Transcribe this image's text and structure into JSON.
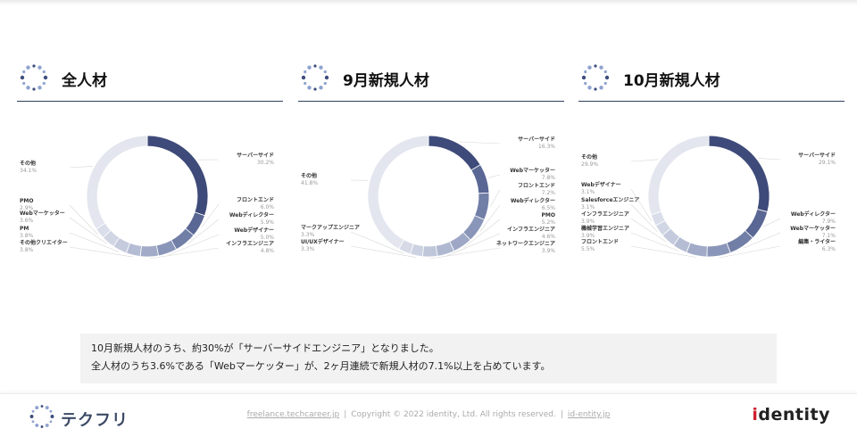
{
  "chart_data": [
    {
      "type": "pie",
      "donut": true,
      "title": "全人材",
      "slices": [
        {
          "name": "サーバーサイド",
          "value": 30.2,
          "label": "30.2%",
          "color": "#3e4a79"
        },
        {
          "name": "フロントエンド",
          "value": 6.0,
          "label": "6.0%",
          "color": "#5a6794"
        },
        {
          "name": "Webディレクター",
          "value": 5.9,
          "label": "5.9%",
          "color": "#717ea6"
        },
        {
          "name": "Webデザイナー",
          "value": 5.0,
          "label": "5.0%",
          "color": "#8a96b9"
        },
        {
          "name": "インフラエンジニア",
          "value": 4.8,
          "label": "4.8%",
          "color": "#a1abc8"
        },
        {
          "name": "その他クリエイター",
          "value": 3.8,
          "label": "3.8%",
          "color": "#b5bdd4"
        },
        {
          "name": "PM",
          "value": 3.8,
          "label": "3.8%",
          "color": "#c5cbdd"
        },
        {
          "name": "Webマーケッター",
          "value": 3.6,
          "label": "3.6%",
          "color": "#d1d6e4"
        },
        {
          "name": "PMO",
          "value": 2.9,
          "label": "2.9%",
          "color": "#dadeea"
        },
        {
          "name": "その他",
          "value": 34.1,
          "label": "34.1%",
          "color": "#e3e6ee"
        }
      ]
    },
    {
      "type": "pie",
      "donut": true,
      "title": "9月新規人材",
      "slices": [
        {
          "name": "サーバーサイド",
          "value": 16.3,
          "label": "16.3%",
          "color": "#3e4a79"
        },
        {
          "name": "Webマーケッター",
          "value": 7.8,
          "label": "7.8%",
          "color": "#5a6794"
        },
        {
          "name": "フロントエンド",
          "value": 7.2,
          "label": "7.2%",
          "color": "#717ea6"
        },
        {
          "name": "Webディレクター",
          "value": 6.5,
          "label": "6.5%",
          "color": "#8a96b9"
        },
        {
          "name": "PMO",
          "value": 5.2,
          "label": "5.2%",
          "color": "#9ea8c6"
        },
        {
          "name": "インフラエンジニア",
          "value": 4.6,
          "label": "4.6%",
          "color": "#afb8d0"
        },
        {
          "name": "ネットワークエンジニア",
          "value": 3.9,
          "label": "3.9%",
          "color": "#bfc6da"
        },
        {
          "name": "UI/UXデザイナー",
          "value": 3.3,
          "label": "3.3%",
          "color": "#ccd2e2"
        },
        {
          "name": "マークアップエンジニア",
          "value": 3.3,
          "label": "3.3%",
          "color": "#d6dae7"
        },
        {
          "name": "その他",
          "value": 41.8,
          "label": "41.8%",
          "color": "#e3e6ee"
        }
      ]
    },
    {
      "type": "pie",
      "donut": true,
      "title": "10月新規人材",
      "slices": [
        {
          "name": "サーバーサイド",
          "value": 29.1,
          "label": "29.1%",
          "color": "#3e4a79"
        },
        {
          "name": "Webディレクター",
          "value": 7.9,
          "label": "7.9%",
          "color": "#5a6794"
        },
        {
          "name": "Webマーケッター",
          "value": 7.1,
          "label": "7.1%",
          "color": "#717ea6"
        },
        {
          "name": "編集・ライター",
          "value": 6.3,
          "label": "6.3%",
          "color": "#8a96b9"
        },
        {
          "name": "フロントエンド",
          "value": 5.5,
          "label": "5.5%",
          "color": "#a1abc8"
        },
        {
          "name": "機械学習エンジニア",
          "value": 3.9,
          "label": "3.9%",
          "color": "#b5bdd4"
        },
        {
          "name": "インフラエンジニア",
          "value": 3.9,
          "label": "3.9%",
          "color": "#c5cbdd"
        },
        {
          "name": "Salesforceエンジニア",
          "value": 3.1,
          "label": "3.1%",
          "color": "#d1d6e4"
        },
        {
          "name": "Webデザイナー",
          "value": 3.1,
          "label": "3.1%",
          "color": "#dadeea"
        },
        {
          "name": "その他",
          "value": 29.9,
          "label": "29.9%",
          "color": "#e3e6ee"
        }
      ]
    }
  ],
  "note": {
    "line1": "10月新規人材のうち、約30%が「サーバーサイドエンジニア」となりました。",
    "line2": "全人材のうち3.6%である「Webマーケッター」が、2ヶ月連続で新規人材の7.1%以上を占めています。"
  },
  "footer": {
    "brand": "テクフリ",
    "link1": "freelance.techcareer.jp",
    "copyright": "Copyright © 2022 identity, Ltd. All rights reserved.",
    "link2": "id-entity.jp",
    "separator": "|",
    "logo_accent": "i",
    "logo_rest": "dentity"
  }
}
